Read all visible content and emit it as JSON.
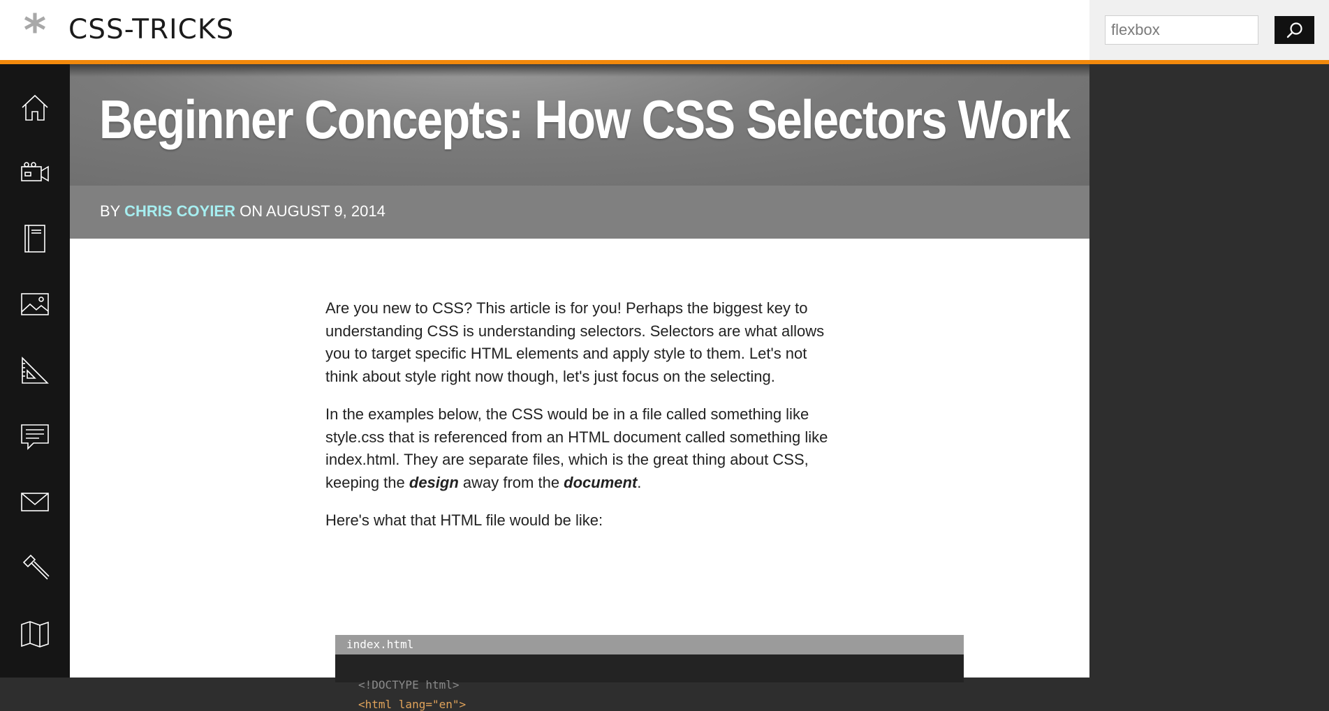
{
  "header": {
    "logo_text": "CSS-TRICKS",
    "search_value": "flexbox",
    "accent_color": "#f2890c"
  },
  "nav": [
    {
      "name": "home-icon"
    },
    {
      "name": "video-icon"
    },
    {
      "name": "book-icon"
    },
    {
      "name": "image-icon"
    },
    {
      "name": "ruler-icon"
    },
    {
      "name": "forums-icon"
    },
    {
      "name": "mail-icon"
    },
    {
      "name": "hammer-icon"
    },
    {
      "name": "map-icon"
    }
  ],
  "article": {
    "title": "Beginner Concepts: How CSS Selectors Work",
    "byline_prefix": "BY",
    "author": "CHRIS COYIER",
    "byline_mid": "ON",
    "date": "AUGUST 9, 2014",
    "p1": "Are you new to CSS? This article is for you! Perhaps the biggest key to understanding CSS is understanding selectors. Selectors are what allows you to target specific HTML elements and apply style to them. Let's not think about style right now though, let's just focus on the selecting.",
    "p2_a": "In the examples below, the CSS would be in a file called something like style.css that is referenced from an HTML document called something like index.html. They are separate files, which is the great thing about CSS, keeping the ",
    "p2_em1": "design",
    "p2_b": " away from the ",
    "p2_em2": "document",
    "p2_c": ".",
    "p3": "Here's what that HTML file would be like:",
    "code_filename": "index.html",
    "code_lines": [
      "<!DOCTYPE html>",
      "<html lang=\"en\">"
    ]
  }
}
